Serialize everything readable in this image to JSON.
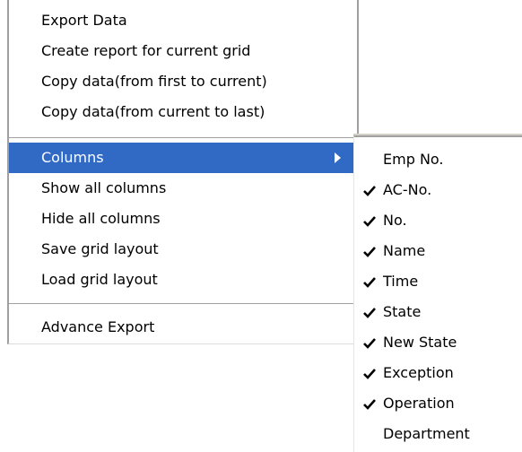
{
  "context_menu": {
    "items": [
      {
        "label": "Export Data"
      },
      {
        "label": "Create report for current grid"
      },
      {
        "label": "Copy data(from first to current)"
      },
      {
        "label": "Copy data(from current to last)"
      },
      {
        "label": "Columns"
      },
      {
        "label": "Show all columns"
      },
      {
        "label": "Hide all columns"
      },
      {
        "label": "Save grid layout"
      },
      {
        "label": "Load grid layout"
      },
      {
        "label": "Advance Export"
      }
    ],
    "highlight_color": "#316ac5"
  },
  "columns_submenu": {
    "items": [
      {
        "label": "Emp No.",
        "checked": false
      },
      {
        "label": "AC-No.",
        "checked": true
      },
      {
        "label": "No.",
        "checked": true
      },
      {
        "label": "Name",
        "checked": true
      },
      {
        "label": "Time",
        "checked": true
      },
      {
        "label": "State",
        "checked": true
      },
      {
        "label": "New State",
        "checked": true
      },
      {
        "label": "Exception",
        "checked": true
      },
      {
        "label": "Operation",
        "checked": true
      },
      {
        "label": "Department",
        "checked": false
      }
    ],
    "check_icon": "checkmark-icon"
  }
}
